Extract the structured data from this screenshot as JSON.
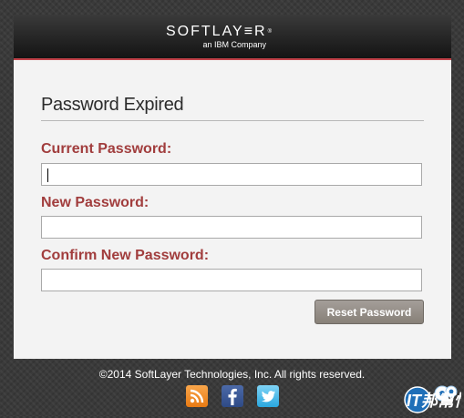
{
  "brand": {
    "logo_text": "SOFTLAY≡R",
    "logo_mark": "®",
    "subtitle": "an IBM Company"
  },
  "form": {
    "title": "Password Expired",
    "current_password_label": "Current Password:",
    "current_password_value": "",
    "new_password_label": "New Password:",
    "new_password_value": "",
    "confirm_password_label": "Confirm New Password:",
    "confirm_password_value": "",
    "submit_label": "Reset Password"
  },
  "footer": {
    "copyright": "©2014 SoftLayer Technologies, Inc. All rights reserved.",
    "social_icons": [
      "rss-icon",
      "facebook-icon",
      "twitter-icon"
    ]
  },
  "watermark": {
    "text": "IT邦幫忙"
  },
  "colors": {
    "accent_red": "#c2434a",
    "label_red": "#a13d3d",
    "button_gray": "#938c85",
    "panel_bg": "#f3f3f3"
  }
}
